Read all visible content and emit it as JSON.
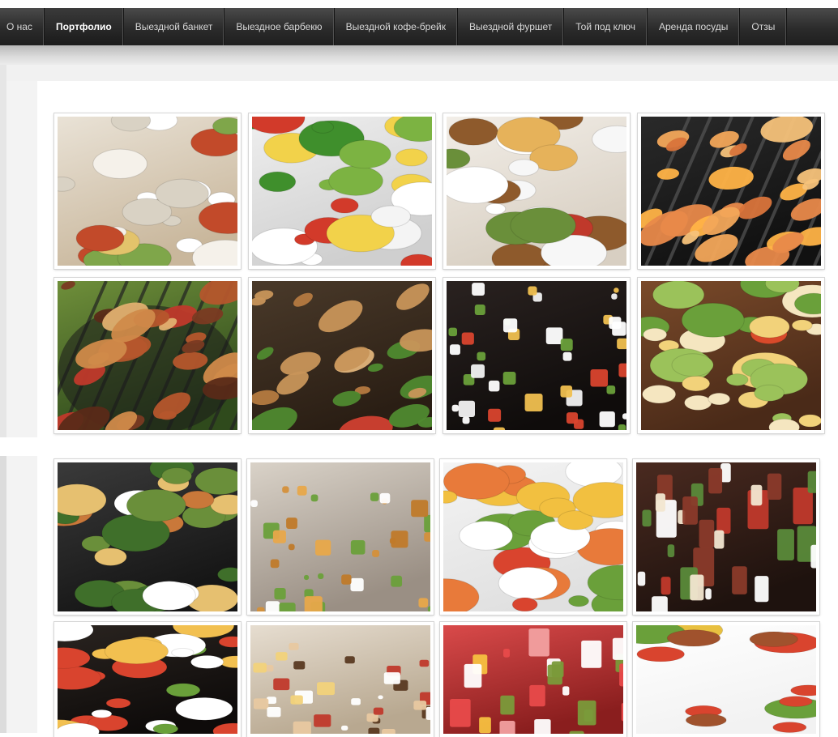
{
  "nav": {
    "items": [
      {
        "label": "О нас",
        "active": false
      },
      {
        "label": "Портфолио",
        "active": true
      },
      {
        "label": "Выездной банкет",
        "active": false
      },
      {
        "label": "Выездное барбекю",
        "active": false
      },
      {
        "label": "Выездной кофе-брейк",
        "active": false
      },
      {
        "label": "Выездной фуршет",
        "active": false
      },
      {
        "label": "Той под ключ",
        "active": false
      },
      {
        "label": "Аренда посуды",
        "active": false
      },
      {
        "label": "Отзы",
        "active": false
      }
    ]
  },
  "colors": {
    "nav_bg": "#2b2b2b",
    "nav_text": "#d8d8d8",
    "nav_active_text": "#ffffff"
  },
  "gallery": {
    "photos": [
      {
        "subject": "banquet-table-icon",
        "theme": "table"
      },
      {
        "subject": "salad-platters-icon",
        "theme": "salads"
      },
      {
        "subject": "served-table-icon",
        "theme": "table2"
      },
      {
        "subject": "grilled-shrimp-icon",
        "theme": "shrimp"
      },
      {
        "subject": "bbq-grill-icon",
        "theme": "grill"
      },
      {
        "subject": "grilled-meat-icon",
        "theme": "meat"
      },
      {
        "subject": "canape-buffet-icon",
        "theme": "canape"
      },
      {
        "subject": "appetizer-platters-icon",
        "theme": "platters"
      },
      {
        "subject": "buffet-line-icon",
        "theme": "buffetline"
      },
      {
        "subject": "tartlets-icon",
        "theme": "tartlets"
      },
      {
        "subject": "buffet-plates-icon",
        "theme": "plates"
      },
      {
        "subject": "dessert-glasses-icon",
        "theme": "glasses"
      },
      {
        "subject": "buffet-trays-icon",
        "theme": "trays"
      },
      {
        "subject": "dessert-stand-icon",
        "theme": "desserts"
      },
      {
        "subject": "fruit-drinks-icon",
        "theme": "drinks"
      },
      {
        "subject": "soup-plates-icon",
        "theme": "soup"
      }
    ]
  }
}
